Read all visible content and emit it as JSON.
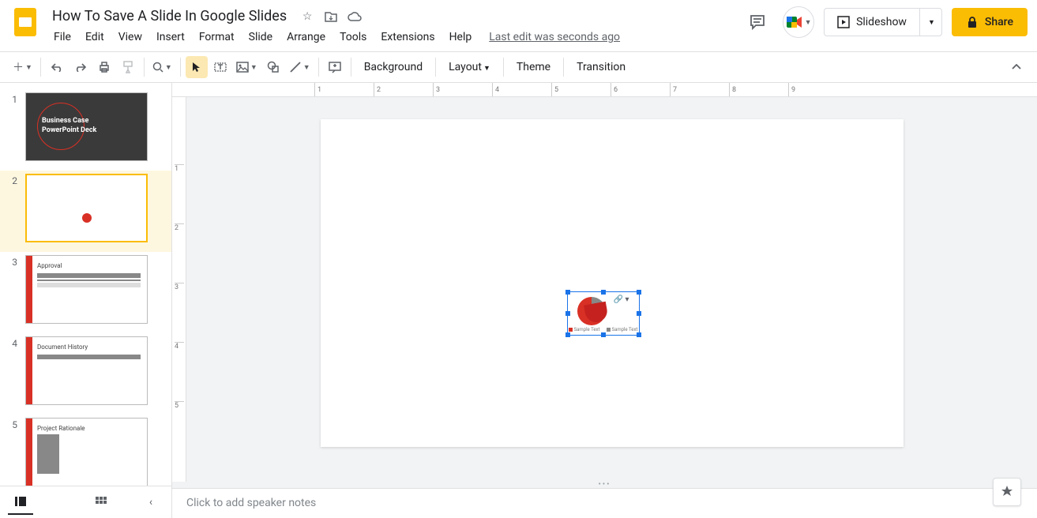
{
  "doc_title": "How To Save A Slide In Google Slides",
  "last_edit": "Last edit was seconds ago",
  "menu": {
    "file": "File",
    "edit": "Edit",
    "view": "View",
    "insert": "Insert",
    "format": "Format",
    "slide": "Slide",
    "arrange": "Arrange",
    "tools": "Tools",
    "extensions": "Extensions",
    "help": "Help"
  },
  "header_buttons": {
    "slideshow": "Slideshow",
    "share": "Share"
  },
  "toolbar": {
    "background": "Background",
    "layout": "Layout",
    "theme": "Theme",
    "transition": "Transition"
  },
  "ruler_marks": [
    "1",
    "2",
    "3",
    "4",
    "5",
    "6",
    "7",
    "8",
    "9"
  ],
  "slides": [
    {
      "num": "1",
      "title": "Business Case\nPowerPoint Deck"
    },
    {
      "num": "2",
      "title": ""
    },
    {
      "num": "3",
      "title": "Approval"
    },
    {
      "num": "4",
      "title": "Document History"
    },
    {
      "num": "5",
      "title": "Project Rationale"
    }
  ],
  "selected_slide": 2,
  "chart_legend": {
    "a": "Sample Text",
    "b": "Sample Text"
  },
  "speaker_notes_placeholder": "Click to add speaker notes"
}
